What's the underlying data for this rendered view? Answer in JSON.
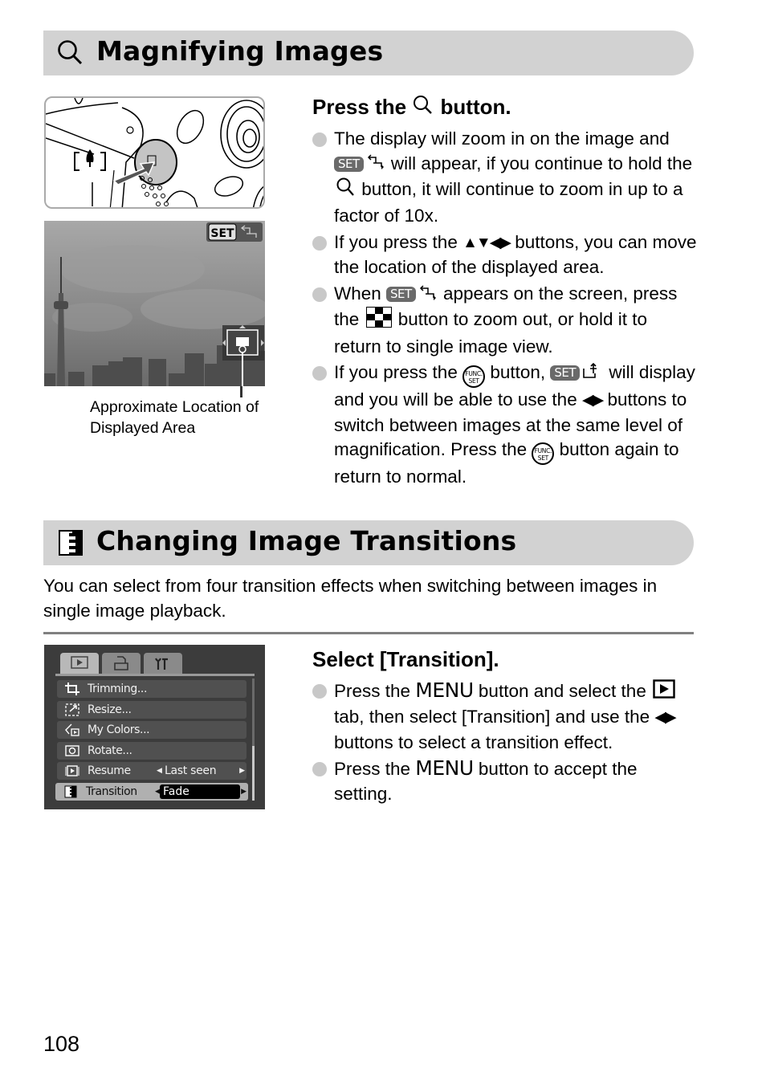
{
  "page_number": "108",
  "section1": {
    "title": "Magnifying Images",
    "icon": "magnify-icon",
    "figure_caption": [
      "Approximate Location of",
      "Displayed Area"
    ],
    "screen_overlay": {
      "set_label": "SET",
      "icon": "zoom-move-icon"
    },
    "step_title": {
      "before": "Press the",
      "icon": "magnify-icon",
      "after": "button."
    },
    "bullets": [
      {
        "parts": [
          {
            "t": "The display will zoom in on the image and "
          },
          {
            "badge": "SET"
          },
          {
            "icon": "zoom-move-icon"
          },
          {
            "t": " will appear, if you continue to hold the "
          },
          {
            "icon": "magnify-icon"
          },
          {
            "t": " button, it will continue to zoom in up to a factor of 10x."
          }
        ]
      },
      {
        "parts": [
          {
            "t": "If you press the "
          },
          {
            "arrows": "▲▼◀▶"
          },
          {
            "t": " buttons, you can move the location of the displayed area."
          }
        ]
      },
      {
        "parts": [
          {
            "t": "When "
          },
          {
            "badge": "SET"
          },
          {
            "icon": "zoom-move-icon"
          },
          {
            "t": " appears on the screen, press the "
          },
          {
            "icon": "index-icon"
          },
          {
            "t": " button to zoom out, or hold it to return to single image view."
          }
        ]
      },
      {
        "parts": [
          {
            "t": "If you press the "
          },
          {
            "func": [
              "FUNC.",
              "SET"
            ]
          },
          {
            "t": " button, "
          },
          {
            "badge": "SET"
          },
          {
            "icon": "image-jump-icon"
          },
          {
            "t": " will display and you will be able to use the "
          },
          {
            "arrows": "◀▶"
          },
          {
            "t": " buttons to switch between images at the same level of magnification. Press the "
          },
          {
            "func": [
              "FUNC.",
              "SET"
            ]
          },
          {
            "t": " button again to return to normal."
          }
        ]
      }
    ]
  },
  "section2": {
    "title": "Changing Image Transitions",
    "icon": "transition-icon",
    "intro": "You can select from four transition effects when switching between images in single image playback.",
    "step_title": "Select [Transition].",
    "bullets": [
      {
        "parts": [
          {
            "t": "Press the "
          },
          {
            "menu": "MENU"
          },
          {
            "t": " button and select the "
          },
          {
            "icon": "playback-tab-icon"
          },
          {
            "t": " tab, then select [Transition] and use the "
          },
          {
            "arrows": "◀▶"
          },
          {
            "t": " buttons to select a transition effect."
          }
        ]
      },
      {
        "parts": [
          {
            "t": "Press the "
          },
          {
            "menu": "MENU"
          },
          {
            "t": " button to accept the setting."
          }
        ]
      }
    ],
    "camera_menu": {
      "tabs": [
        {
          "name": "playback-tab",
          "icon": "playback-icon",
          "active": true
        },
        {
          "name": "print-tab",
          "icon": "print-icon",
          "active": false
        },
        {
          "name": "settings-tab",
          "icon": "tools-icon",
          "active": false
        }
      ],
      "items": [
        {
          "icon": "trimming-icon",
          "label": "Trimming...",
          "value": ""
        },
        {
          "icon": "resize-icon",
          "label": "Resize...",
          "value": ""
        },
        {
          "icon": "my-colors-icon",
          "label": "My Colors...",
          "value": ""
        },
        {
          "icon": "rotate-icon",
          "label": "Rotate...",
          "value": ""
        },
        {
          "icon": "resume-icon",
          "label": "Resume",
          "value": "Last seen"
        },
        {
          "icon": "transition-icon",
          "label": "Transition",
          "value": "Fade",
          "selected": true
        }
      ],
      "scroll_position": 0.55
    }
  }
}
